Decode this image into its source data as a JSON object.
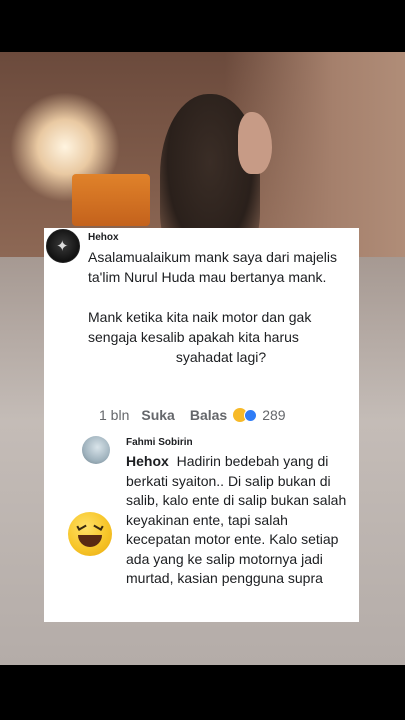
{
  "comment": {
    "author": "Hehox",
    "paragraph1": "Asalamualaikum mank saya dari majelis ta'lim Nurul Huda mau bertanya mank.",
    "paragraph2_line1": "Mank ketika kita naik motor dan gak sengaja kesalib apakah kita harus",
    "paragraph2_line2": "syahadat lagi?",
    "time": "1 bln",
    "like_label": "Suka",
    "reply_label": "Balas",
    "reaction_count": "289",
    "reaction_icons": [
      "laughing-emoji-icon",
      "like-thumb-icon"
    ]
  },
  "reply": {
    "author": "Fahmi Sobirin",
    "mention": "Hehox",
    "text": "Hadirin bedebah yang di berkati syaiton.. Di salip bukan di salib, kalo ente di salip bukan salah keyakinan ente, tapi salah kecepatan motor ente. Kalo setiap ada yang ke salip motornya jadi murtad, kasian pengguna supra"
  },
  "colors": {
    "text": "#1c1e21",
    "secondary_text": "#65676b",
    "card_bg": "#ffffff",
    "emoji_yellow": "#f7b928"
  }
}
